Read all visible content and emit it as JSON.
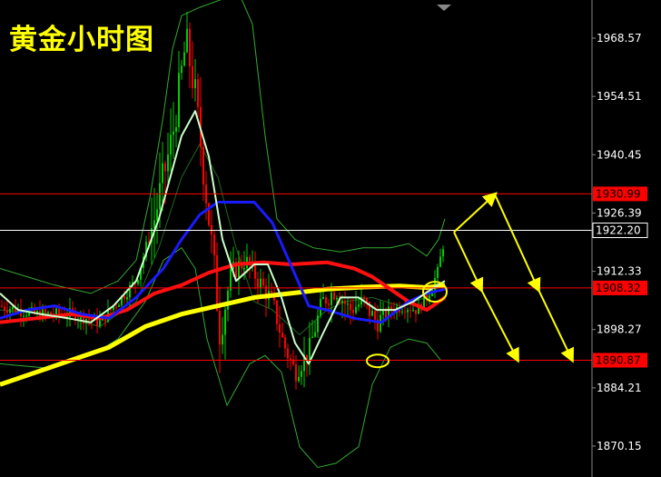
{
  "title": "黄金小时图",
  "colors": {
    "background": "#000000",
    "bull": "#00cc00",
    "bear": "#ff0000",
    "ma_yellow": "#ffff00",
    "ma_red": "#ff1010",
    "ma_blue": "#1a1aff",
    "ma_white": "#ccffcc",
    "bollinger": "#33aa33",
    "level_line": "#ff0000",
    "current_line": "#ffffff",
    "annotation": "#ffff00"
  },
  "chart_data": {
    "type": "candlestick",
    "title": "黄金小时图",
    "ylim": [
      1864.5,
      1976.5
    ],
    "y_ticks": [
      "1968.57",
      "1954.51",
      "1940.45",
      "1926.39",
      "1912.33",
      "1898.27",
      "1884.21",
      "1870.15"
    ],
    "current_price": "1922.20",
    "levels": [
      {
        "label": "1930.99",
        "value": 1930.99
      },
      {
        "label": "1908.32",
        "value": 1908.32
      },
      {
        "label": "1890.87",
        "value": 1890.87
      }
    ],
    "projection": [
      {
        "from": [
          0,
          1921.8
        ],
        "to": [
          1,
          1930.9
        ]
      },
      {
        "from": [
          1,
          1930.9
        ],
        "to": [
          2,
          1907.9
        ]
      },
      {
        "from": [
          0,
          1921.8
        ],
        "to": [
          1,
          1907.9
        ]
      },
      {
        "from": [
          1,
          1907.9
        ],
        "to": [
          2,
          1891.0
        ]
      },
      {
        "from": [
          2,
          1907.9
        ],
        "to": [
          3,
          1891.0
        ]
      }
    ]
  }
}
